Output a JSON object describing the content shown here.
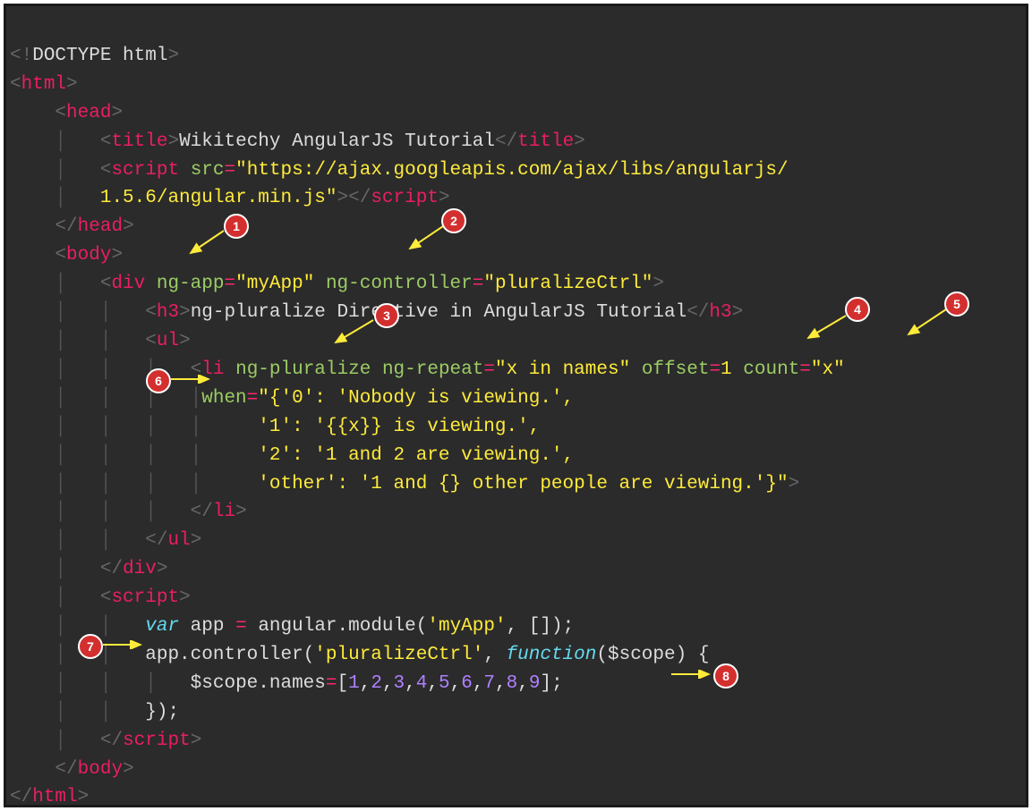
{
  "code": {
    "line1_doctype_open": "<!",
    "line1_doctype_text": "DOCTYPE html",
    "line1_doctype_close": ">",
    "html_tag": "html",
    "head_tag": "head",
    "title_tag": "title",
    "title_text": "Wikitechy AngularJS Tutorial",
    "script_tag": "script",
    "src_attr": "src",
    "src_val": "\"https://ajax.googleapis.com/ajax/libs/angularjs/",
    "src_val2": "1.5.6/angular.min.js\"",
    "body_tag": "body",
    "div_tag": "div",
    "ngapp_attr": "ng-app",
    "ngapp_val": "\"myApp\"",
    "ngcontroller_attr": "ng-controller",
    "ngcontroller_val": "\"pluralizeCtrl\"",
    "h3_tag": "h3",
    "h3_text": "ng-pluralize Directive in AngularJS Tutorial",
    "ul_tag": "ul",
    "li_tag": "li",
    "ngpluralize_attr": "ng-pluralize",
    "ngrepeat_attr": "ng-repeat",
    "ngrepeat_val": "\"x in names\"",
    "offset_attr": "offset",
    "offset_val": "1",
    "count_attr": "count",
    "count_val": "\"x\"",
    "when_attr": "when",
    "when_val1": "\"{'0': 'Nobody is viewing.',",
    "when_val2": "'1': '{{x}} is viewing.',",
    "when_val3": "'2': '1 and 2 are viewing.',",
    "when_val4": "'other': '1 and {} other people are viewing.'}\"",
    "var_kw": "var",
    "app_var": "app",
    "angular_module": "angular.module",
    "myapp_str": "'myApp'",
    "controller_method": "app.controller",
    "ctrl_str": "'pluralizeCtrl'",
    "function_kw": "function",
    "scope_param": "$scope",
    "scope_names": "$scope.names",
    "array_open": "[",
    "n1": "1",
    "n2": "2",
    "n3": "3",
    "n4": "4",
    "n5": "5",
    "n6": "6",
    "n7": "7",
    "n8": "8",
    "n9": "9",
    "array_close": "]"
  },
  "annotations": {
    "b1": "1",
    "b2": "2",
    "b3": "3",
    "b4": "4",
    "b5": "5",
    "b6": "6",
    "b7": "7",
    "b8": "8"
  }
}
